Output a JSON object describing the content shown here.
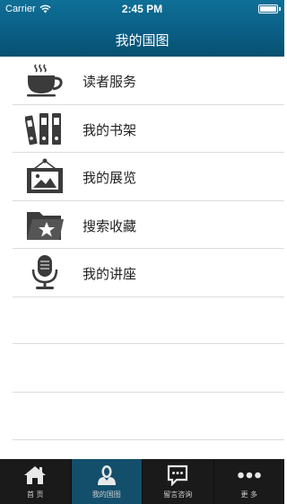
{
  "status_bar": {
    "carrier": "Carrier",
    "time": "2:45 PM"
  },
  "nav": {
    "title": "我的国图"
  },
  "menu": [
    {
      "label": "读者服务",
      "icon": "coffee-cup-icon"
    },
    {
      "label": "我的书架",
      "icon": "binders-icon"
    },
    {
      "label": "我的展览",
      "icon": "picture-frame-icon"
    },
    {
      "label": "搜索收藏",
      "icon": "folder-star-icon"
    },
    {
      "label": "我的讲座",
      "icon": "microphone-icon"
    }
  ],
  "tabs": [
    {
      "label": "首 页",
      "icon": "home-icon"
    },
    {
      "label": "我的国图",
      "icon": "user-icon",
      "active": true
    },
    {
      "label": "留言咨询",
      "icon": "chat-bubble-icon"
    },
    {
      "label": "更 多",
      "icon": "more-dots-icon"
    }
  ],
  "colors": {
    "header": "#0a5f86",
    "tabbar": "#1a1a1a",
    "tab_active": "#134e6b",
    "icon": "#3b3b3b"
  }
}
